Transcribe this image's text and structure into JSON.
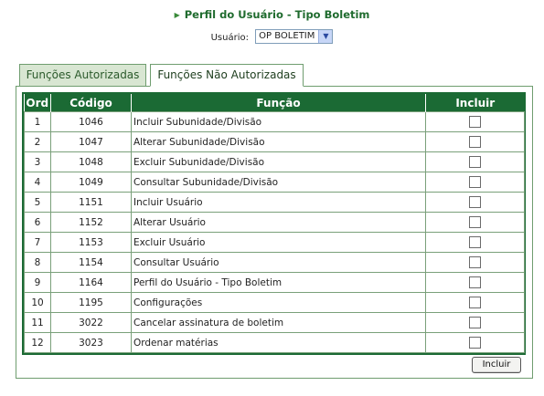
{
  "page": {
    "title": "Perfil do Usuário - Tipo Boletim",
    "user_label": "Usuário:",
    "user_value": "OP BOLETIM"
  },
  "tabs": [
    {
      "label": "Funções Autorizadas",
      "active": false
    },
    {
      "label": "Funções Não Autorizadas",
      "active": true
    }
  ],
  "table": {
    "headers": [
      "Ord",
      "Código",
      "Função",
      "Incluir"
    ],
    "rows": [
      {
        "ord": "1",
        "codigo": "1046",
        "funcao": "Incluir Subunidade/Divisão"
      },
      {
        "ord": "2",
        "codigo": "1047",
        "funcao": "Alterar Subunidade/Divisão"
      },
      {
        "ord": "3",
        "codigo": "1048",
        "funcao": "Excluir Subunidade/Divisão"
      },
      {
        "ord": "4",
        "codigo": "1049",
        "funcao": "Consultar Subunidade/Divisão"
      },
      {
        "ord": "5",
        "codigo": "1151",
        "funcao": "Incluir Usuário"
      },
      {
        "ord": "6",
        "codigo": "1152",
        "funcao": "Alterar Usuário"
      },
      {
        "ord": "7",
        "codigo": "1153",
        "funcao": "Excluir Usuário"
      },
      {
        "ord": "8",
        "codigo": "1154",
        "funcao": "Consultar Usuário"
      },
      {
        "ord": "9",
        "codigo": "1164",
        "funcao": "Perfil do Usuário - Tipo Boletim"
      },
      {
        "ord": "10",
        "codigo": "1195",
        "funcao": "Configurações"
      },
      {
        "ord": "11",
        "codigo": "3022",
        "funcao": "Cancelar assinatura de boletim"
      },
      {
        "ord": "12",
        "codigo": "3023",
        "funcao": "Ordenar matérias"
      }
    ]
  },
  "actions": {
    "include_label": "Incluir"
  },
  "colors": {
    "header_green": "#1b6a34",
    "title_green": "#1f6b2e",
    "tab_inactive_bg": "#d8e6d2"
  }
}
